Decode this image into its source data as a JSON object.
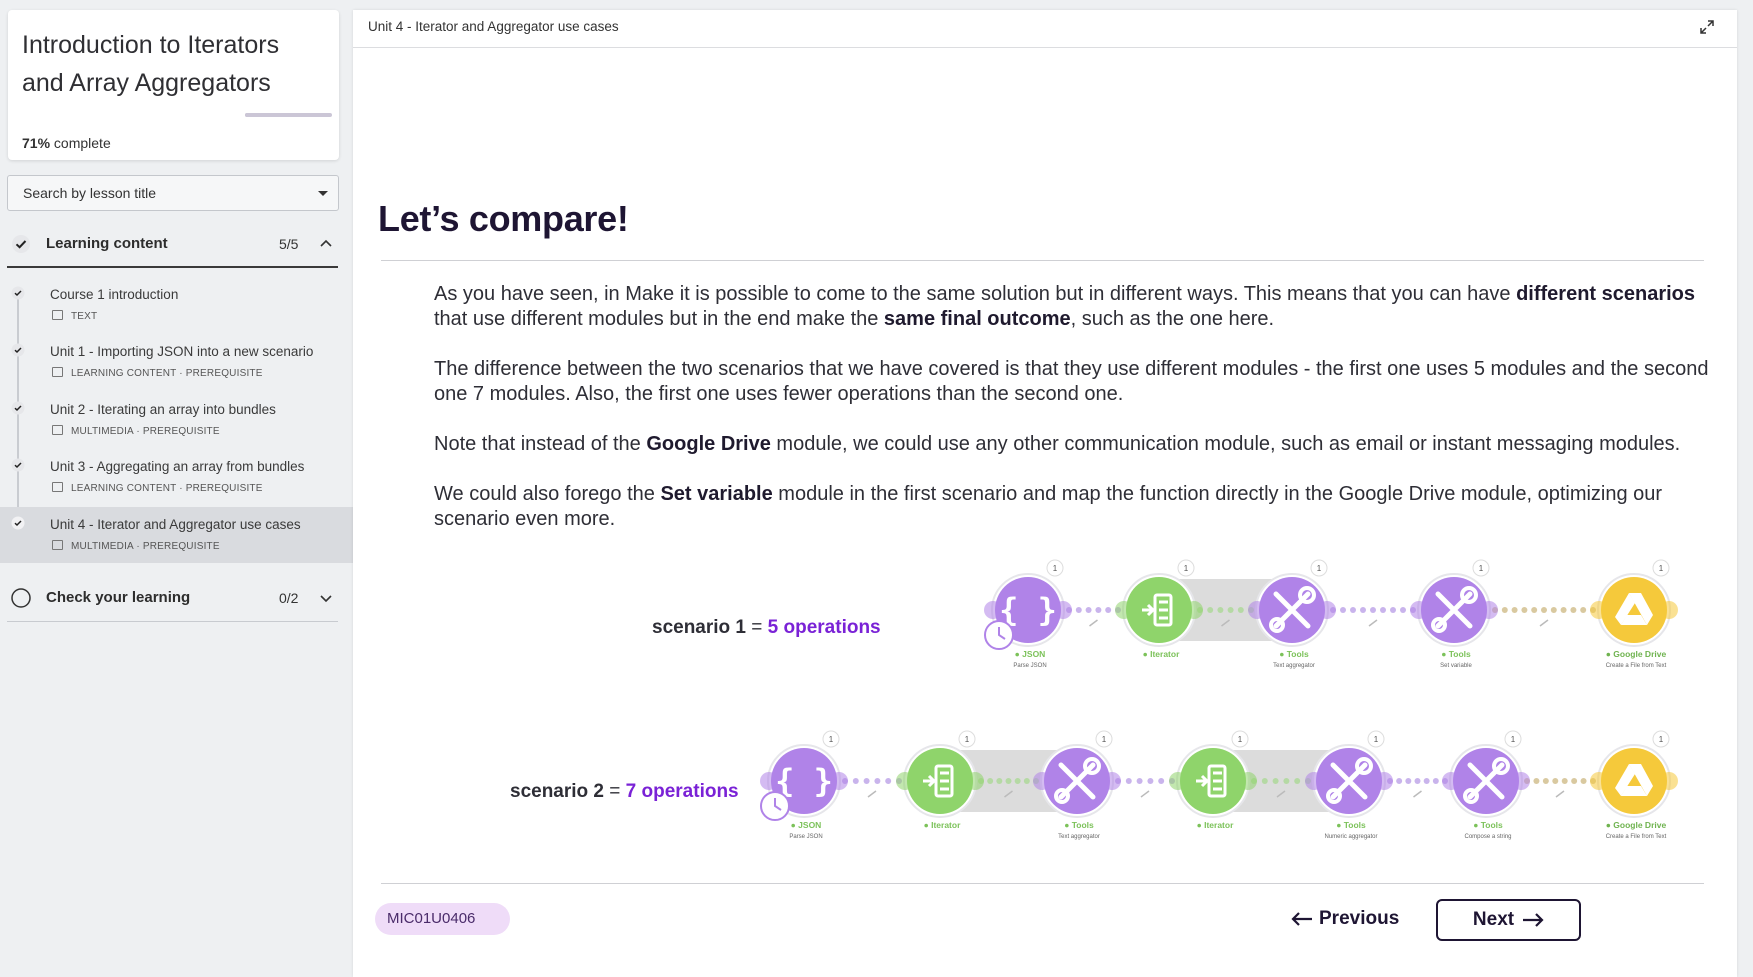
{
  "sidebar": {
    "course_title": "Introduction to Iterators and Array Aggregators",
    "progress_percent": "71%",
    "progress_suffix": " complete",
    "progress_fraction": 0.71,
    "search_placeholder": "Search by lesson title",
    "sections": [
      {
        "label": "Learning content",
        "count": "5/5"
      },
      {
        "label": "Check your learning",
        "count": "0/2"
      }
    ],
    "lessons": [
      {
        "title": "Course 1 introduction",
        "meta": "TEXT"
      },
      {
        "title": "Unit 1 - Importing JSON into a new scenario",
        "meta": "LEARNING CONTENT · PREREQUISITE"
      },
      {
        "title": "Unit 2 - Iterating an array into bundles",
        "meta": "MULTIMEDIA · PREREQUISITE"
      },
      {
        "title": "Unit 3 - Aggregating an array from bundles",
        "meta": "LEARNING CONTENT · PREREQUISITE"
      },
      {
        "title": "Unit 4 - Iterator and Aggregator use cases",
        "meta": "MULTIMEDIA · PREREQUISITE"
      }
    ]
  },
  "main": {
    "unit_label": "Unit 4 - Iterator and Aggregator use cases",
    "heading": "Let’s compare!",
    "paragraphs": [
      [
        "As you have seen, in Make it is possible to come to the same solution but in different ways. This means that you can have ",
        "different scenarios",
        " that use different modules but in the end make the ",
        "same final outcome",
        ", such as the one here."
      ],
      [
        "The difference between the two scenarios that we have covered is that they use different modules - the first one uses 5 modules and the second one 7 modules. Also, the first one uses fewer operations than the second one."
      ],
      [
        "Note that instead of the ",
        "Google Drive",
        " module, we could use any other communication module, such as email or instant messaging modules."
      ],
      [
        "We could also forego the ",
        "Set variable",
        " module in the first scenario and map the function directly in the Google Drive module, optimizing our scenario even more."
      ]
    ],
    "scenario1": {
      "name": "scenario 1",
      "eq": " = ",
      "ops": "5 operations"
    },
    "scenario2": {
      "name": "scenario 2",
      "eq": " = ",
      "ops": "7 operations"
    },
    "flow1": [
      {
        "type": "json",
        "name": "JSON",
        "sub": "Parse JSON"
      },
      {
        "type": "iterator",
        "name": "Iterator",
        "sub": ""
      },
      {
        "type": "tools",
        "name": "Tools",
        "sub": "Text aggregator"
      },
      {
        "type": "tools",
        "name": "Tools",
        "sub": "Set variable"
      },
      {
        "type": "drive",
        "name": "Google Drive",
        "sub": "Create a File from Text"
      }
    ],
    "flow2": [
      {
        "type": "json",
        "name": "JSON",
        "sub": "Parse JSON"
      },
      {
        "type": "iterator",
        "name": "Iterator",
        "sub": ""
      },
      {
        "type": "tools",
        "name": "Tools",
        "sub": "Text aggregator"
      },
      {
        "type": "iterator",
        "name": "Iterator",
        "sub": ""
      },
      {
        "type": "tools",
        "name": "Tools",
        "sub": "Numeric aggregator"
      },
      {
        "type": "tools",
        "name": "Tools",
        "sub": "Compose a string"
      },
      {
        "type": "drive",
        "name": "Google Drive",
        "sub": "Create a File from Text"
      }
    ],
    "op_badge": "1",
    "code": "MIC01U0406",
    "prev_label": "Previous",
    "next_label": "Next"
  },
  "colors": {
    "purple_module": "#b083e8",
    "green_module": "#8fd46b",
    "yellow_module": "#f5c93b",
    "accent": "#7a22d6",
    "ink": "#1e1533"
  }
}
